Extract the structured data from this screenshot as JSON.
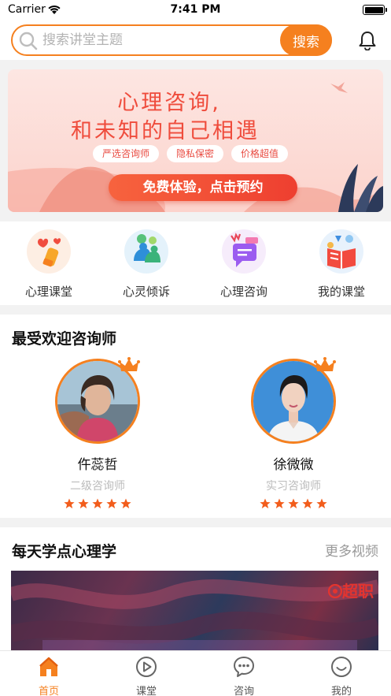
{
  "status_bar": {
    "carrier": "Carrier",
    "time": "7:41 PM"
  },
  "search": {
    "placeholder": "搜索讲堂主题",
    "button_label": "搜索"
  },
  "banner": {
    "title_line1": "心理咨询,",
    "title_line2": "和未知的自己相遇",
    "tags": [
      "严选咨询师",
      "隐私保密",
      "价格超值"
    ],
    "cta": "免费体验，点击预约"
  },
  "categories": [
    {
      "label": "心理课堂",
      "icon": "brush-icon"
    },
    {
      "label": "心灵倾诉",
      "icon": "people-chat-icon"
    },
    {
      "label": "心理咨询",
      "icon": "chat-bubble-icon"
    },
    {
      "label": "我的课堂",
      "icon": "book-icon"
    }
  ],
  "popular": {
    "title": "最受欢迎咨询师",
    "counselors": [
      {
        "name": "仵蕊哲",
        "level": "二级咨询师",
        "rating": 5
      },
      {
        "name": "徐微微",
        "level": "实习咨询师",
        "rating": 5
      }
    ]
  },
  "learn": {
    "title": "每天学点心理学",
    "more": "更多视频",
    "video_logo": "超职"
  },
  "tabs": [
    {
      "label": "首页",
      "icon": "home-icon",
      "active": true
    },
    {
      "label": "课堂",
      "icon": "play-icon",
      "active": false
    },
    {
      "label": "咨询",
      "icon": "chat-icon",
      "active": false
    },
    {
      "label": "我的",
      "icon": "smile-icon",
      "active": false
    }
  ],
  "colors": {
    "accent": "#f5801f",
    "banner_red": "#ef4c3c",
    "star": "#f25d1c"
  }
}
